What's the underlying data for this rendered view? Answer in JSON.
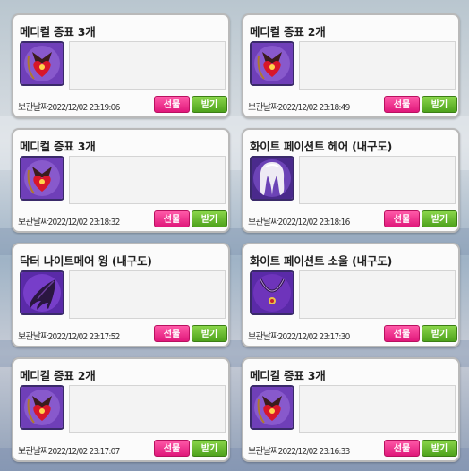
{
  "cards": [
    {
      "title": "메디컬 증표 3개",
      "icon": "medical-badge-icon",
      "date": "보관날짜2022/12/02 23:19:06",
      "gift": "선물",
      "receive": "받기"
    },
    {
      "title": "메디컬 증표 2개",
      "icon": "medical-badge-icon",
      "date": "보관날짜2022/12/02 23:18:49",
      "gift": "선물",
      "receive": "받기"
    },
    {
      "title": "메디컬 증표 3개",
      "icon": "medical-badge-icon",
      "date": "보관날짜2022/12/02 23:18:32",
      "gift": "선물",
      "receive": "받기"
    },
    {
      "title": "화이트 페이션트 헤어 (내구도)",
      "icon": "white-hair-icon",
      "date": "보관날짜2022/12/02 23:18:16",
      "gift": "선물",
      "receive": "받기"
    },
    {
      "title": "닥터 나이트메어 윙 (내구도)",
      "icon": "dark-wing-icon",
      "date": "보관날짜2022/12/02 23:17:52",
      "gift": "선물",
      "receive": "받기"
    },
    {
      "title": "화이트 페이션트 소울 (내구도)",
      "icon": "soul-necklace-icon",
      "date": "보관날짜2022/12/02 23:17:30",
      "gift": "선물",
      "receive": "받기"
    },
    {
      "title": "메디컬 증표 2개",
      "icon": "medical-badge-icon",
      "date": "보관날짜2022/12/02 23:17:07",
      "gift": "선물",
      "receive": "받기"
    },
    {
      "title": "메디컬 증표 3개",
      "icon": "medical-badge-icon",
      "date": "보관날짜2022/12/02 23:16:33",
      "gift": "선물",
      "receive": "받기"
    }
  ],
  "colors": {
    "gift": "#e0177a",
    "receive": "#4ea21c",
    "card_border": "#b9b9b9"
  }
}
